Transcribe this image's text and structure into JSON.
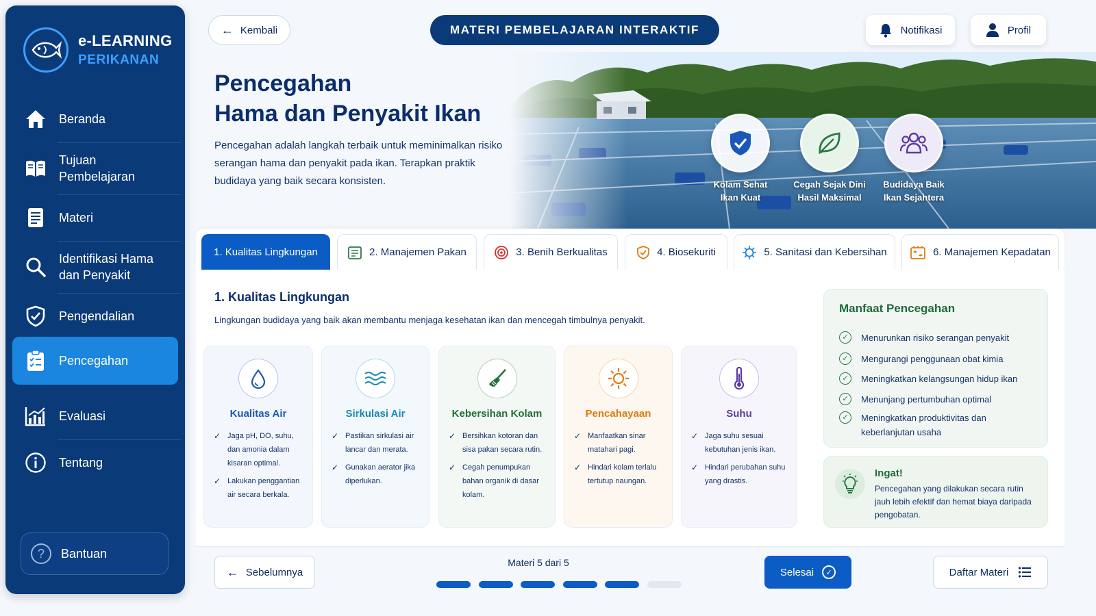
{
  "app": {
    "logo_line1": "e-LEARNING",
    "logo_line2": "PERIKANAN"
  },
  "sidebar": {
    "items": [
      {
        "label": "Beranda",
        "icon": "home-icon"
      },
      {
        "label": "Tujuan Pembelajaran",
        "icon": "book-open-icon"
      },
      {
        "label": "Materi",
        "icon": "document-icon"
      },
      {
        "label": "Identifikasi Hama dan Penyakit",
        "icon": "search-icon"
      },
      {
        "label": "Pengendalian",
        "icon": "shield-icon"
      },
      {
        "label": "Pencegahan",
        "icon": "clipboard-check-icon",
        "active": true
      },
      {
        "label": "Evaluasi",
        "icon": "chart-icon"
      },
      {
        "label": "Tentang",
        "icon": "info-icon"
      }
    ],
    "help_label": "Bantuan"
  },
  "topbar": {
    "back_label": "Kembali",
    "title": "MATERI PEMBELAJARAN INTERAKTIF",
    "notif_label": "Notifikasi",
    "profile_label": "Profil"
  },
  "hero": {
    "title_line1": "Pencegahan",
    "title_line2": "Hama dan Penyakit Ikan",
    "description": "Pencegahan adalah langkah terbaik untuk meminimalkan risiko serangan hama dan penyakit pada ikan. Terapkan praktik budidaya yang baik secara konsisten.",
    "badges": [
      {
        "line1": "Kolam Sehat",
        "line2": "Ikan Kuat",
        "icon": "shield-check-icon"
      },
      {
        "line1": "Cegah Sejak Dini",
        "line2": "Hasil Maksimal",
        "icon": "leaf-icon"
      },
      {
        "line1": "Budidaya Baik",
        "line2": "Ikan Sejahtera",
        "icon": "people-icon"
      }
    ]
  },
  "tabs": [
    {
      "label": "1. Kualitas Lingkungan",
      "active": true
    },
    {
      "label": "2. Manajemen Pakan",
      "icon": "feed-list-icon"
    },
    {
      "label": "3. Benih Berkualitas",
      "icon": "fish-egg-icon"
    },
    {
      "label": "4. Biosekuriti",
      "icon": "shield-icon"
    },
    {
      "label": "5. Sanitasi dan Kebersihan",
      "icon": "virus-icon"
    },
    {
      "label": "6. Manajemen Kepadatan",
      "icon": "fish-crowd-icon"
    }
  ],
  "section": {
    "title": "1. Kualitas Lingkungan",
    "description": "Lingkungan budidaya yang baik akan membantu menjaga kesehatan ikan dan mencegah timbulnya penyakit."
  },
  "cards": [
    {
      "title": "Kualitas Air",
      "icon": "water-drop-icon",
      "color": "#1b57b8",
      "bg": "#f3f7fd",
      "points": [
        "Jaga pH, DO, suhu, dan amonia dalam kisaran optimal.",
        "Lakukan penggantian air secara berkala."
      ]
    },
    {
      "title": "Sirkulasi Air",
      "icon": "waves-icon",
      "color": "#1a8ab5",
      "bg": "#f2f8fb",
      "points": [
        "Pastikan sirkulasi air lancar dan merata.",
        "Gunakan aerator jika diperlukan."
      ]
    },
    {
      "title": "Kebersihan Kolam",
      "icon": "broom-icon",
      "color": "#22703a",
      "bg": "#f3f8f4",
      "points": [
        "Bersihkan kotoran dan sisa pakan secara rutin.",
        "Cegah penumpukan bahan organik di dasar kolam."
      ]
    },
    {
      "title": "Pencahayaan",
      "icon": "sun-icon",
      "color": "#e07b10",
      "bg": "#fdf7ef",
      "points": [
        "Manfaatkan sinar matahari pagi.",
        "Hindari kolam terlalu tertutup naungan."
      ]
    },
    {
      "title": "Suhu",
      "icon": "thermometer-icon",
      "color": "#5a3aa6",
      "bg": "#f6f5fc",
      "points": [
        "Jaga suhu sesuai kebutuhan jenis ikan.",
        "Hindari perubahan suhu yang drastis."
      ]
    }
  ],
  "benefits": {
    "title": "Manfaat Pencegahan",
    "items": [
      "Menurunkan risiko serangan penyakit",
      "Mengurangi penggunaan obat kimia",
      "Meningkatkan kelangsungan hidup ikan",
      "Menunjang pertumbuhan optimal",
      "Meningkatkan produktivitas dan keberlanjutan usaha"
    ]
  },
  "reminder": {
    "title": "Ingat!",
    "text": "Pencegahan yang dilakukan secara rutin jauh lebih efektif dan hemat biaya daripada pengobatan."
  },
  "footer": {
    "prev_label": "Sebelumnya",
    "progress_label": "Materi 5 dari 5",
    "progress_current": 5,
    "progress_total": 5,
    "finish_label": "Selesai",
    "list_label": "Daftar Materi"
  },
  "colors": {
    "primary": "#0b3a78",
    "accent": "#0b5cc4",
    "active_nav": "#1a86e0",
    "green": "#1e6b3a"
  }
}
